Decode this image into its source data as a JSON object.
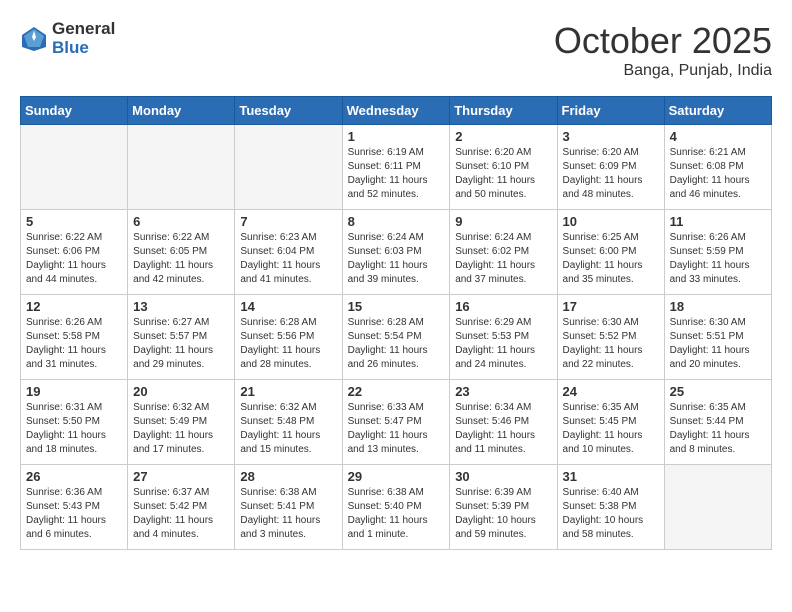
{
  "logo": {
    "general": "General",
    "blue": "Blue"
  },
  "title": "October 2025",
  "location": "Banga, Punjab, India",
  "days_of_week": [
    "Sunday",
    "Monday",
    "Tuesday",
    "Wednesday",
    "Thursday",
    "Friday",
    "Saturday"
  ],
  "weeks": [
    [
      {
        "num": "",
        "info": ""
      },
      {
        "num": "",
        "info": ""
      },
      {
        "num": "",
        "info": ""
      },
      {
        "num": "1",
        "info": "Sunrise: 6:19 AM\nSunset: 6:11 PM\nDaylight: 11 hours\nand 52 minutes."
      },
      {
        "num": "2",
        "info": "Sunrise: 6:20 AM\nSunset: 6:10 PM\nDaylight: 11 hours\nand 50 minutes."
      },
      {
        "num": "3",
        "info": "Sunrise: 6:20 AM\nSunset: 6:09 PM\nDaylight: 11 hours\nand 48 minutes."
      },
      {
        "num": "4",
        "info": "Sunrise: 6:21 AM\nSunset: 6:08 PM\nDaylight: 11 hours\nand 46 minutes."
      }
    ],
    [
      {
        "num": "5",
        "info": "Sunrise: 6:22 AM\nSunset: 6:06 PM\nDaylight: 11 hours\nand 44 minutes."
      },
      {
        "num": "6",
        "info": "Sunrise: 6:22 AM\nSunset: 6:05 PM\nDaylight: 11 hours\nand 42 minutes."
      },
      {
        "num": "7",
        "info": "Sunrise: 6:23 AM\nSunset: 6:04 PM\nDaylight: 11 hours\nand 41 minutes."
      },
      {
        "num": "8",
        "info": "Sunrise: 6:24 AM\nSunset: 6:03 PM\nDaylight: 11 hours\nand 39 minutes."
      },
      {
        "num": "9",
        "info": "Sunrise: 6:24 AM\nSunset: 6:02 PM\nDaylight: 11 hours\nand 37 minutes."
      },
      {
        "num": "10",
        "info": "Sunrise: 6:25 AM\nSunset: 6:00 PM\nDaylight: 11 hours\nand 35 minutes."
      },
      {
        "num": "11",
        "info": "Sunrise: 6:26 AM\nSunset: 5:59 PM\nDaylight: 11 hours\nand 33 minutes."
      }
    ],
    [
      {
        "num": "12",
        "info": "Sunrise: 6:26 AM\nSunset: 5:58 PM\nDaylight: 11 hours\nand 31 minutes."
      },
      {
        "num": "13",
        "info": "Sunrise: 6:27 AM\nSunset: 5:57 PM\nDaylight: 11 hours\nand 29 minutes."
      },
      {
        "num": "14",
        "info": "Sunrise: 6:28 AM\nSunset: 5:56 PM\nDaylight: 11 hours\nand 28 minutes."
      },
      {
        "num": "15",
        "info": "Sunrise: 6:28 AM\nSunset: 5:54 PM\nDaylight: 11 hours\nand 26 minutes."
      },
      {
        "num": "16",
        "info": "Sunrise: 6:29 AM\nSunset: 5:53 PM\nDaylight: 11 hours\nand 24 minutes."
      },
      {
        "num": "17",
        "info": "Sunrise: 6:30 AM\nSunset: 5:52 PM\nDaylight: 11 hours\nand 22 minutes."
      },
      {
        "num": "18",
        "info": "Sunrise: 6:30 AM\nSunset: 5:51 PM\nDaylight: 11 hours\nand 20 minutes."
      }
    ],
    [
      {
        "num": "19",
        "info": "Sunrise: 6:31 AM\nSunset: 5:50 PM\nDaylight: 11 hours\nand 18 minutes."
      },
      {
        "num": "20",
        "info": "Sunrise: 6:32 AM\nSunset: 5:49 PM\nDaylight: 11 hours\nand 17 minutes."
      },
      {
        "num": "21",
        "info": "Sunrise: 6:32 AM\nSunset: 5:48 PM\nDaylight: 11 hours\nand 15 minutes."
      },
      {
        "num": "22",
        "info": "Sunrise: 6:33 AM\nSunset: 5:47 PM\nDaylight: 11 hours\nand 13 minutes."
      },
      {
        "num": "23",
        "info": "Sunrise: 6:34 AM\nSunset: 5:46 PM\nDaylight: 11 hours\nand 11 minutes."
      },
      {
        "num": "24",
        "info": "Sunrise: 6:35 AM\nSunset: 5:45 PM\nDaylight: 11 hours\nand 10 minutes."
      },
      {
        "num": "25",
        "info": "Sunrise: 6:35 AM\nSunset: 5:44 PM\nDaylight: 11 hours\nand 8 minutes."
      }
    ],
    [
      {
        "num": "26",
        "info": "Sunrise: 6:36 AM\nSunset: 5:43 PM\nDaylight: 11 hours\nand 6 minutes."
      },
      {
        "num": "27",
        "info": "Sunrise: 6:37 AM\nSunset: 5:42 PM\nDaylight: 11 hours\nand 4 minutes."
      },
      {
        "num": "28",
        "info": "Sunrise: 6:38 AM\nSunset: 5:41 PM\nDaylight: 11 hours\nand 3 minutes."
      },
      {
        "num": "29",
        "info": "Sunrise: 6:38 AM\nSunset: 5:40 PM\nDaylight: 11 hours\nand 1 minute."
      },
      {
        "num": "30",
        "info": "Sunrise: 6:39 AM\nSunset: 5:39 PM\nDaylight: 10 hours\nand 59 minutes."
      },
      {
        "num": "31",
        "info": "Sunrise: 6:40 AM\nSunset: 5:38 PM\nDaylight: 10 hours\nand 58 minutes."
      },
      {
        "num": "",
        "info": ""
      }
    ]
  ]
}
